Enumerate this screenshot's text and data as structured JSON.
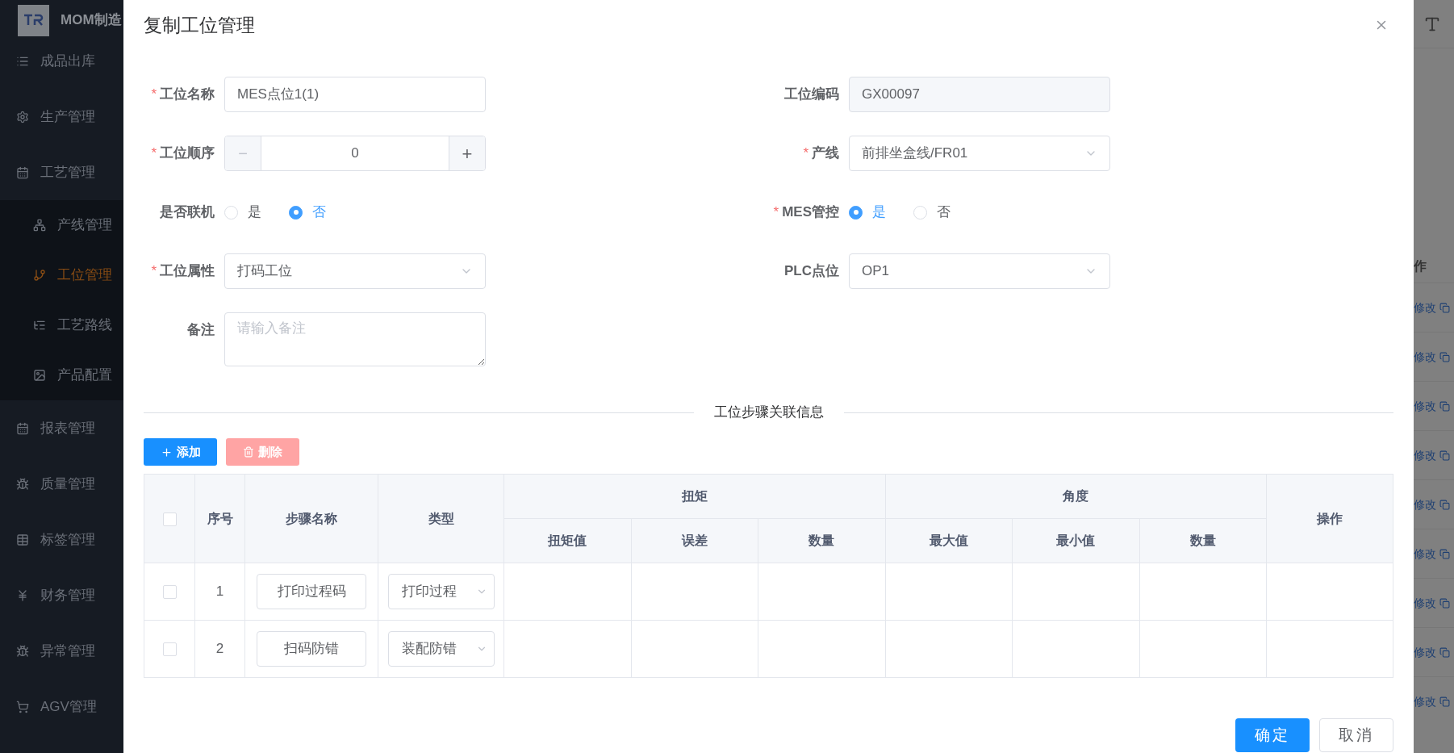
{
  "sidebar": {
    "brand": "MOM制造",
    "items": [
      {
        "label": "成品出库",
        "selected": false
      },
      {
        "label": "生产管理",
        "selected": false
      },
      {
        "label": "工艺管理",
        "selected": false,
        "expanded": true,
        "children": [
          {
            "label": "产线管理",
            "selected": false
          },
          {
            "label": "工位管理",
            "selected": true
          },
          {
            "label": "工艺路线",
            "selected": false
          },
          {
            "label": "产品配置",
            "selected": false
          }
        ]
      },
      {
        "label": "报表管理",
        "selected": false
      },
      {
        "label": "质量管理",
        "selected": false
      },
      {
        "label": "标签管理",
        "selected": false
      },
      {
        "label": "财务管理",
        "selected": false
      },
      {
        "label": "异常管理",
        "selected": false
      },
      {
        "label": "AGV管理",
        "selected": false
      }
    ]
  },
  "background": {
    "column_header": "作",
    "row_actions": [
      "修改",
      "修改",
      "修改",
      "修改",
      "修改",
      "修改",
      "修改",
      "修改",
      "修改"
    ]
  },
  "dialog": {
    "title": "复制工位管理",
    "fields": [
      {
        "kind": "input",
        "label": "工位名称",
        "required_mark": "*",
        "value": "MES点位1(1)"
      },
      {
        "kind": "readonly",
        "label": "工位编码",
        "value": "GX00097"
      },
      {
        "kind": "number",
        "label": "工位顺序",
        "required_mark": "*",
        "value": "0",
        "minus": "−",
        "plus": "+"
      },
      {
        "kind": "select",
        "label": "产线",
        "required_mark": "*",
        "value": "前排坐盒线/FR01"
      },
      {
        "kind": "radio",
        "label": "是否联机",
        "options": [
          {
            "label": "是",
            "selected": false
          },
          {
            "label": "否",
            "selected": true
          }
        ]
      },
      {
        "kind": "radio",
        "label": "MES管控",
        "required_mark": "*",
        "options": [
          {
            "label": "是",
            "selected": true
          },
          {
            "label": "否",
            "selected": false
          }
        ]
      },
      {
        "kind": "select",
        "label": "工位属性",
        "required_mark": "*",
        "value": "打码工位"
      },
      {
        "kind": "select",
        "label": "PLC点位",
        "value": "OP1"
      },
      {
        "kind": "textarea",
        "label": "备注",
        "placeholder": "请输入备注"
      }
    ],
    "section_title": "工位步骤关联信息",
    "add_button": "添加",
    "delete_button": {
      "label": "删除",
      "disabled": true
    },
    "table": {
      "all_checked": false,
      "columns": [
        "序号",
        "步骤名称",
        "类型"
      ],
      "groups": [
        {
          "label": "扭矩",
          "columns": [
            "扭矩值",
            "误差",
            "数量"
          ]
        },
        {
          "label": "角度",
          "columns": [
            "最大值",
            "最小值",
            "数量"
          ]
        }
      ],
      "action_column": "操作",
      "rows": [
        {
          "index": "1",
          "step_name": "打印过程码",
          "type": "打印过程",
          "checked": false
        },
        {
          "index": "2",
          "step_name": "扫码防错",
          "type": "装配防错",
          "checked": false
        }
      ]
    },
    "buttons": [
      {
        "label": "确定",
        "kind": "primary"
      },
      {
        "label": "取消",
        "kind": "default"
      }
    ]
  }
}
